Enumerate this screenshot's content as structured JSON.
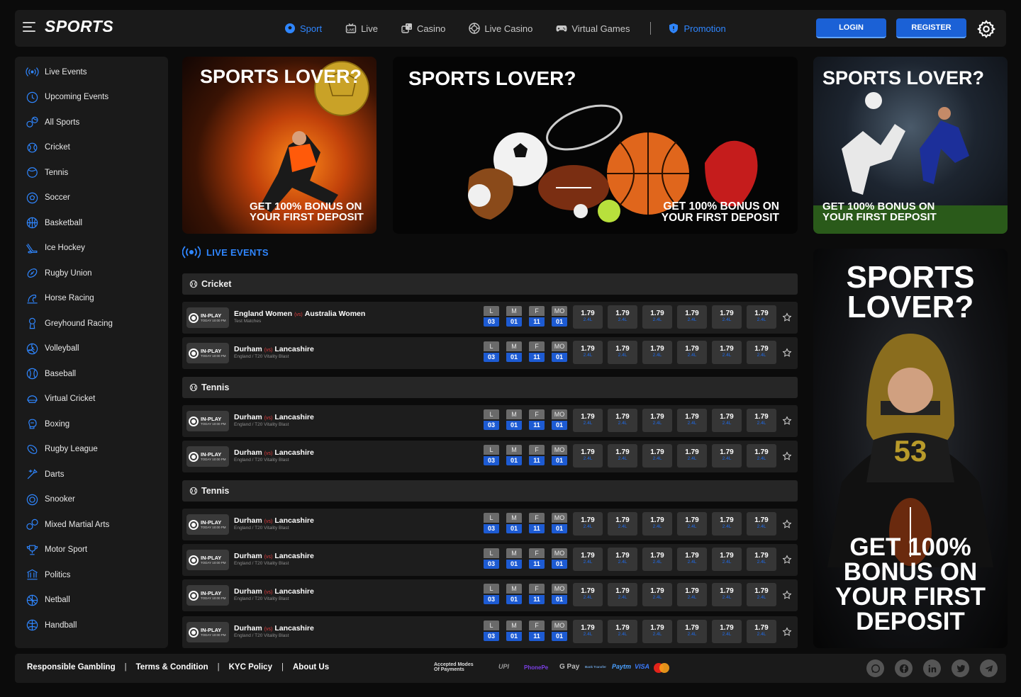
{
  "header": {
    "logo": "SPORTS",
    "nav": [
      {
        "label": "Sport",
        "icon": "soccer-ball-icon",
        "active": true
      },
      {
        "label": "Live",
        "icon": "live-tv-icon",
        "active": false
      },
      {
        "label": "Casino",
        "icon": "dice-icon",
        "active": false
      },
      {
        "label": "Live Casino",
        "icon": "casino-chip-icon",
        "active": false
      },
      {
        "label": "Virtual Games",
        "icon": "gamepad-icon",
        "active": false
      },
      {
        "label": "Promotion",
        "icon": "shield-badge-icon",
        "active": false,
        "accent": true
      }
    ],
    "login_label": "LOGIN",
    "register_label": "REGISTER"
  },
  "sidebar": {
    "items": [
      {
        "label": "Live Events",
        "icon": "live-broadcast-icon"
      },
      {
        "label": "Upcoming Events",
        "icon": "clock-icon"
      },
      {
        "label": "All Sports",
        "icon": "all-sports-icon"
      },
      {
        "label": "Cricket",
        "icon": "cricket-icon"
      },
      {
        "label": "Tennis",
        "icon": "tennis-icon"
      },
      {
        "label": "Soccer",
        "icon": "soccer-icon"
      },
      {
        "label": "Basketball",
        "icon": "basketball-icon"
      },
      {
        "label": "Ice Hockey",
        "icon": "ice-hockey-icon"
      },
      {
        "label": "Rugby Union",
        "icon": "rugby-icon"
      },
      {
        "label": "Horse Racing",
        "icon": "horse-icon"
      },
      {
        "label": "Greyhound Racing",
        "icon": "greyhound-icon"
      },
      {
        "label": "Volleyball",
        "icon": "volleyball-icon"
      },
      {
        "label": "Baseball",
        "icon": "baseball-icon"
      },
      {
        "label": "Virtual Cricket",
        "icon": "virtual-cricket-icon"
      },
      {
        "label": "Boxing",
        "icon": "boxing-glove-icon"
      },
      {
        "label": "Rugby League",
        "icon": "rugby-league-icon"
      },
      {
        "label": "Darts",
        "icon": "darts-icon"
      },
      {
        "label": "Snooker",
        "icon": "snooker-icon"
      },
      {
        "label": "Mixed Martial Arts",
        "icon": "mma-icon"
      },
      {
        "label": "Motor Sport",
        "icon": "trophy-icon"
      },
      {
        "label": "Politics",
        "icon": "politics-icon"
      },
      {
        "label": "Netball",
        "icon": "netball-icon"
      },
      {
        "label": "Handball",
        "icon": "handball-icon"
      }
    ]
  },
  "banners": {
    "b1_title": "SPORTS LOVER?",
    "b1_sub": "GET 100% BONUS ON YOUR FIRST DEPOSIT",
    "b2_title": "SPORTS LOVER?",
    "b2_sub": "GET 100% BONUS ON YOUR FIRST DEPOSIT",
    "b3_title": "SPORTS LOVER?",
    "b3_sub": "GET 100% BONUS ON YOUR FIRST DEPOSIT",
    "b4_title": "SPORTS LOVER?",
    "b4_sub": "GET 100% BONUS ON YOUR FIRST DEPOSIT"
  },
  "live_events": {
    "title": "LIVE EVENTS",
    "col_labels": [
      "L",
      "M",
      "F",
      "MO"
    ],
    "sections": [
      {
        "title": "Cricket",
        "rows": [
          {
            "team1": "England Women",
            "team2": "Australia Women",
            "league": "Test Matches"
          },
          {
            "team1": "Durham",
            "team2": "Lancashire",
            "league": "England / T20 Vitality Blast"
          }
        ]
      },
      {
        "title": "Tennis",
        "rows": [
          {
            "team1": "Durham",
            "team2": "Lancashire",
            "league": "England / T20 Vitality Blast"
          },
          {
            "team1": "Durham",
            "team2": "Lancashire",
            "league": "England / T20 Vitality Blast"
          }
        ]
      },
      {
        "title": "Tennis",
        "rows": [
          {
            "team1": "Durham",
            "team2": "Lancashire",
            "league": "England / T20 Vitality Blast"
          },
          {
            "team1": "Durham",
            "team2": "Lancashire",
            "league": "England / T20 Vitality Blast"
          },
          {
            "team1": "Durham",
            "team2": "Lancashire",
            "league": "England / T20 Vitality Blast"
          },
          {
            "team1": "Durham",
            "team2": "Lancashire",
            "league": "England / T20 Vitality Blast"
          }
        ]
      }
    ],
    "inplay_label": "IN-PLAY",
    "inplay_time": "TODAY 10:00 PM",
    "vs_label": "(vs)",
    "lmf_values": [
      "03",
      "01",
      "11",
      "01"
    ],
    "odds_value": "1.79",
    "odds_sub": "2.4L",
    "odds_count": 6
  },
  "footer": {
    "links": [
      "Responsible Gambling",
      "Terms & Condition",
      "KYC Policy",
      "About Us"
    ],
    "accepted_line1": "Accepted Modes",
    "accepted_line2": "Of Payments",
    "payments": [
      "UPI",
      "PhonePe",
      "G Pay",
      "Bank Transfer",
      "Paytm",
      "VISA",
      "MasterCard"
    ],
    "social": [
      "whatsapp-icon",
      "facebook-icon",
      "linkedin-icon",
      "twitter-icon",
      "telegram-icon"
    ]
  },
  "colors": {
    "accent": "#2f86ff",
    "button": "#1b61d6",
    "panel": "#1a1a1a",
    "bg": "#0b0b0b"
  }
}
